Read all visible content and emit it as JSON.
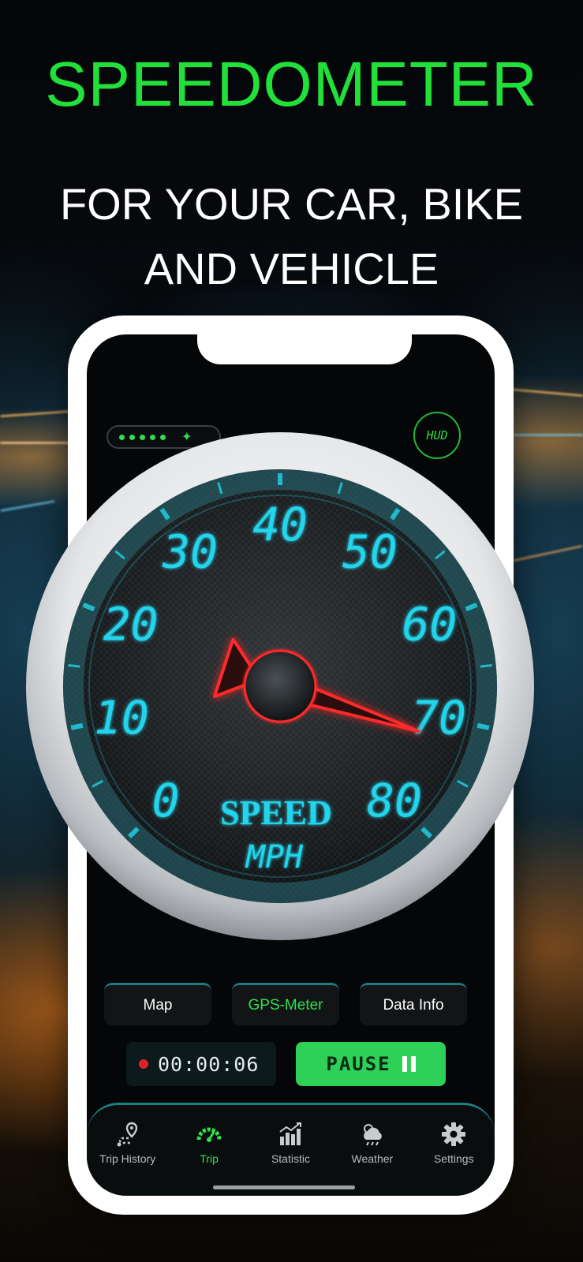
{
  "headline": "SPEEDOMETER",
  "subline": {
    "line1": "FOR YOUR CAR, BIKE",
    "line2": "AND VEHICLE"
  },
  "status": {
    "gps_signal_dots": 5,
    "hud_label": "HUD"
  },
  "gauge": {
    "unit_title": "SPEED",
    "unit": "MPH",
    "labels": [
      "0",
      "10",
      "20",
      "30",
      "40",
      "50",
      "60",
      "70",
      "80"
    ],
    "current_speed": 72
  },
  "tabs": [
    {
      "label": "Map",
      "active": false
    },
    {
      "label": "GPS-Meter",
      "active": true
    },
    {
      "label": "Data Info",
      "active": false
    }
  ],
  "timer": {
    "value": "00:00:06"
  },
  "pause_button": {
    "label": "PAUSE"
  },
  "nav": [
    {
      "label": "Trip History",
      "icon": "route-pin-icon",
      "active": false
    },
    {
      "label": "Trip",
      "icon": "speedometer-icon",
      "active": true
    },
    {
      "label": "Statistic",
      "icon": "bar-chart-icon",
      "active": false
    },
    {
      "label": "Weather",
      "icon": "weather-cloud-icon",
      "active": false
    },
    {
      "label": "Settings",
      "icon": "gear-icon",
      "active": false
    }
  ],
  "colors": {
    "accent_green": "#2ee04a",
    "gauge_cyan": "#21d4ec",
    "needle_red": "#ff2a2a",
    "tab_border": "#1e7a83"
  }
}
